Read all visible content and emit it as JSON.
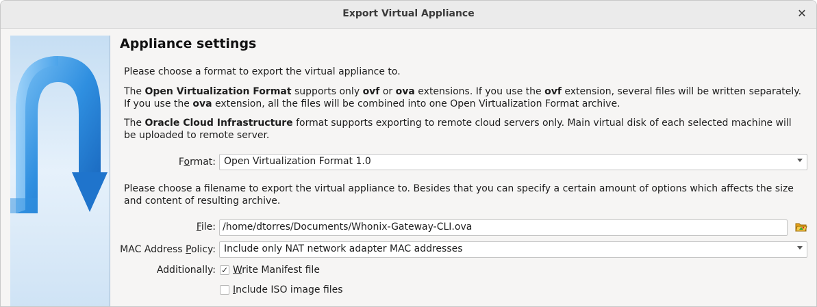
{
  "window": {
    "title": "Export Virtual Appliance",
    "close_glyph": "✕"
  },
  "page": {
    "heading": "Appliance settings",
    "intro": "Please choose a format to export the virtual appliance to.",
    "ovf": {
      "pre": "The ",
      "bold1": "Open Virtualization Format",
      "mid1": " supports only ",
      "bold2": "ovf",
      "mid2": " or ",
      "bold3": "ova",
      "mid3": " extensions. If you use the ",
      "bold4": "ovf",
      "mid4": " extension, several files will be written separately. If you use the ",
      "bold5": "ova",
      "post": " extension, all the files will be combined into one Open Virtualization Format archive."
    },
    "oci": {
      "pre": "The ",
      "bold": "Oracle Cloud Infrastructure",
      "post": " format supports exporting to remote cloud servers only. Main virtual disk of each selected machine will be uploaded to remote server."
    },
    "filename_intro": "Please choose a filename to export the virtual appliance to. Besides that you can specify a certain amount of options which affects the size and content of resulting archive."
  },
  "form": {
    "format_label_pre": "F",
    "format_label_u": "o",
    "format_label_post": "rmat:",
    "format_value": "Open Virtualization Format 1.0",
    "file_label_u": "F",
    "file_label_post": "ile:",
    "file_value": "/home/dtorres/Documents/Whonix-Gateway-CLI.ova",
    "mac_label_pre": "MAC Address ",
    "mac_label_u": "P",
    "mac_label_post": "olicy:",
    "mac_value": "Include only NAT network adapter MAC addresses",
    "additionally_label": "Additionally:",
    "manifest_u": "W",
    "manifest_post": "rite Manifest file",
    "manifest_checked": true,
    "iso_u": "I",
    "iso_post": "nclude ISO image files",
    "iso_checked": false
  },
  "icons": {
    "folder": "folder-open-icon",
    "close": "close-icon",
    "banner": "vbox-export-banner"
  }
}
